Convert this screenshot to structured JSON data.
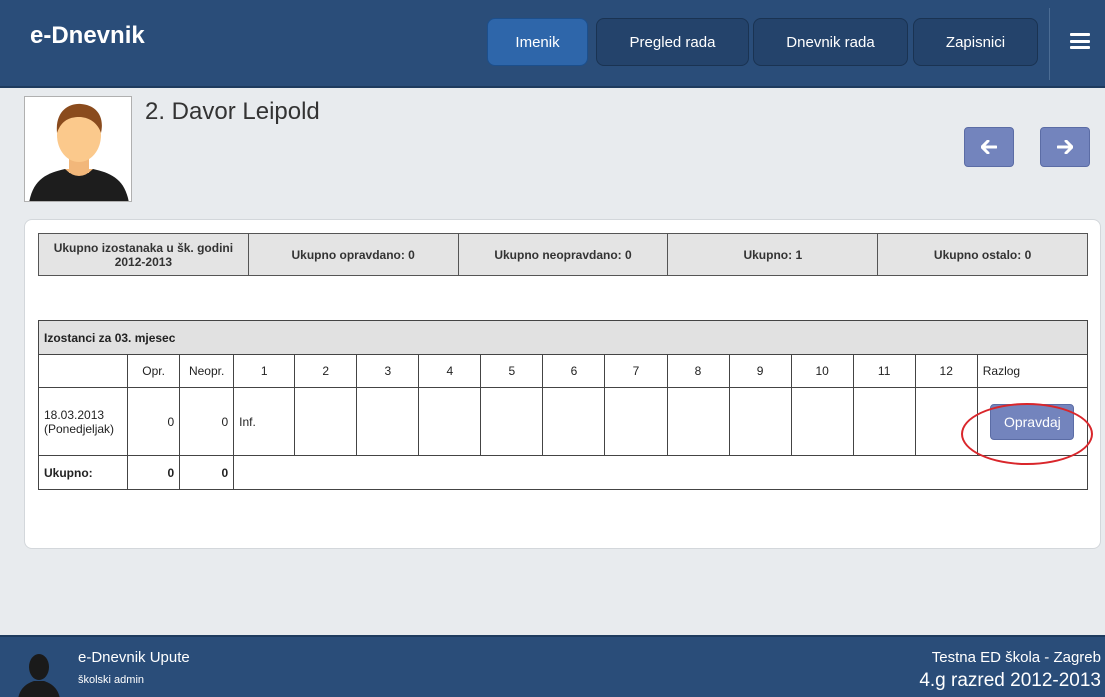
{
  "header": {
    "brand": "e-Dnevnik",
    "nav": [
      {
        "label": "Imenik",
        "active": true
      },
      {
        "label": "Pregled rada",
        "active": false
      },
      {
        "label": "Dnevnik rada",
        "active": false
      },
      {
        "label": "Zapisnici",
        "active": false
      }
    ]
  },
  "student": {
    "name": "2. Davor Leipold"
  },
  "summary": {
    "total_year": "Ukupno izostanaka u šk. godini 2012-2013",
    "justified": "Ukupno opravdano: 0",
    "unjustified": "Ukupno neopravdano: 0",
    "total": "Ukupno: 1",
    "other": "Ukupno ostalo: 0"
  },
  "absences": {
    "title": "Izostanci za 03. mjesec",
    "columns": {
      "opr": "Opr.",
      "neopr": "Neopr.",
      "hours": [
        "1",
        "2",
        "3",
        "4",
        "5",
        "6",
        "7",
        "8",
        "9",
        "10",
        "11",
        "12"
      ],
      "reason": "Razlog"
    },
    "rows": [
      {
        "date": "18.03.2013",
        "day": "(Ponedjeljak)",
        "opr": "0",
        "neopr": "0",
        "hour_1": "Inf.",
        "action_label": "Opravdaj"
      }
    ],
    "total": {
      "label": "Ukupno:",
      "opr": "0",
      "neopr": "0"
    }
  },
  "footer": {
    "app": "e-Dnevnik Upute",
    "role": "školski admin",
    "school": "Testna ED škola - Zagreb",
    "class": "4.g razred 2012-2013"
  },
  "colors": {
    "header_bg": "#2a4d79",
    "nav_active": "#2e66aa",
    "button": "#7384bd",
    "highlight": "#d9262b"
  }
}
